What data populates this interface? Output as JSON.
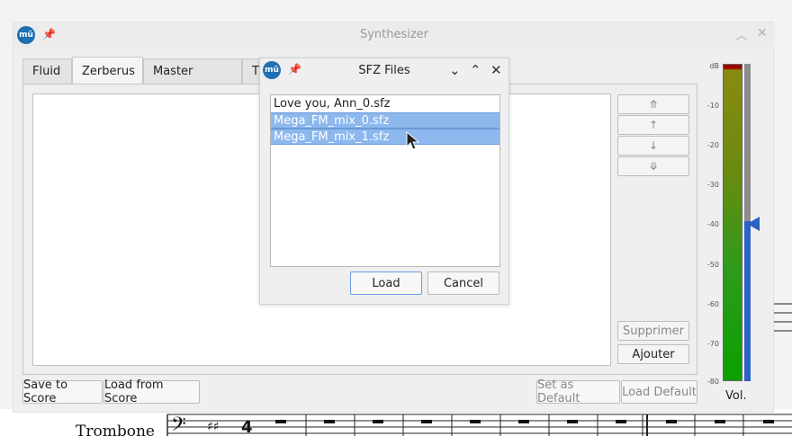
{
  "synth": {
    "title": "Synthesizer",
    "tabs": [
      {
        "label": "Fluid"
      },
      {
        "label": "Zerberus"
      },
      {
        "label": "Master Effects"
      },
      {
        "label": "T"
      }
    ],
    "side_buttons": {
      "move_top": "⤊",
      "move_up": "↑",
      "move_down": "↓",
      "move_bottom": "⤋",
      "remove": "Supprimer",
      "add": "Ajouter"
    },
    "bottom_buttons": {
      "save_to_score": "Save to Score",
      "load_from_score": "Load from Score",
      "set_as_default": "Set as Default",
      "load_default": "Load Default"
    },
    "meter": {
      "ticks": [
        "dB",
        "-10",
        "-20",
        "-30",
        "-40",
        "-50",
        "-60",
        "-70",
        "-80"
      ],
      "vol_label": "Vol."
    }
  },
  "dialog": {
    "title": "SFZ Files",
    "files": [
      "Love you, Ann_0.sfz",
      "Mega_FM_mix_0.sfz",
      "Mega_FM_mix_1.sfz"
    ],
    "load_label": "Load",
    "cancel_label": "Cancel"
  },
  "score": {
    "instrument": "Trombone"
  },
  "app_icon_text": "mū"
}
